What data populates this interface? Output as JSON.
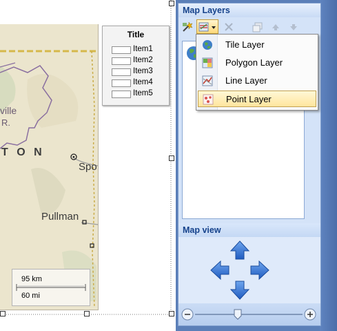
{
  "legend": {
    "title": "Title",
    "items": [
      "Item1",
      "Item2",
      "Item3",
      "Item4",
      "Item5"
    ]
  },
  "map": {
    "labels": {
      "ville": "ville",
      "r": "R.",
      "state": "T O N",
      "spokane": "Spo",
      "pullman": "Pullman"
    },
    "scale": {
      "km": "95 km",
      "mi": "60 mi"
    }
  },
  "panel": {
    "title": "Map Layers",
    "toolbar": [
      "map-wizard-icon",
      "add-layer-icon",
      "delete-icon",
      "layer-properties-icon",
      "move-up-icon",
      "move-down-icon"
    ],
    "mapview_title": "Map view",
    "dropdown": {
      "items": [
        {
          "label": "Tile Layer",
          "icon": "globe-icon"
        },
        {
          "label": "Polygon Layer",
          "icon": "polygon-layer-icon"
        },
        {
          "label": "Line Layer",
          "icon": "line-layer-icon"
        },
        {
          "label": "Point Layer",
          "icon": "point-layer-icon"
        }
      ],
      "selected": "Point Layer"
    }
  },
  "colors": {
    "panel_header_text": "#15428b",
    "panel_bg": "#d4e3f8",
    "arrow_blue": "#2f6fcf",
    "map_road": "#d6b84a"
  }
}
